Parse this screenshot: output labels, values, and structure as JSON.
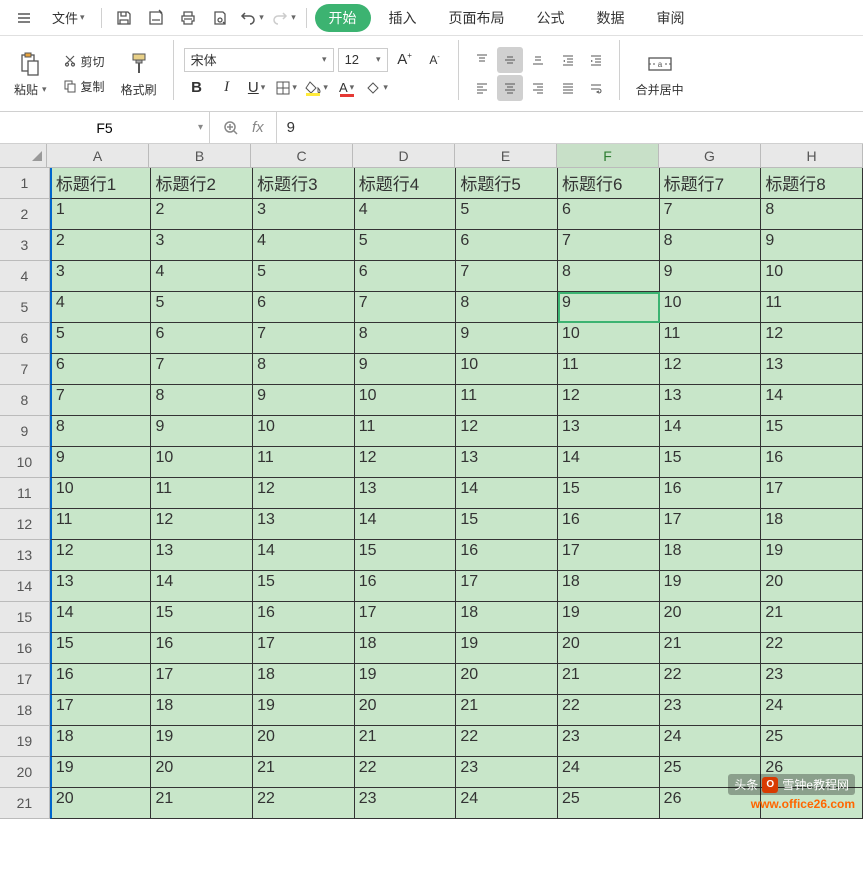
{
  "menubar": {
    "file": "文件",
    "tabs": [
      "开始",
      "插入",
      "页面布局",
      "公式",
      "数据",
      "审阅"
    ]
  },
  "ribbon": {
    "paste": "粘贴",
    "cut": "剪切",
    "copy": "复制",
    "format_painter": "格式刷",
    "font_name": "宋体",
    "font_size": "12",
    "bold": "B",
    "italic": "I",
    "underline": "U",
    "merge_center": "合并居中"
  },
  "formula_bar": {
    "name_box": "F5",
    "fx_label": "fx",
    "formula": "9"
  },
  "chart_data": {
    "type": "table",
    "active_cell": {
      "row": 5,
      "col": "F",
      "value": "9"
    },
    "columns": [
      "A",
      "B",
      "C",
      "D",
      "E",
      "F",
      "G",
      "H"
    ],
    "row_numbers": [
      1,
      2,
      3,
      4,
      5,
      6,
      7,
      8,
      9,
      10,
      11,
      12,
      13,
      14,
      15,
      16,
      17,
      18,
      19,
      20,
      21
    ],
    "headers": [
      "标题行1",
      "标题行2",
      "标题行3",
      "标题行4",
      "标题行5",
      "标题行6",
      "标题行7",
      "标题行8"
    ],
    "data": [
      [
        "1",
        "2",
        "3",
        "4",
        "5",
        "6",
        "7",
        "8"
      ],
      [
        "2",
        "3",
        "4",
        "5",
        "6",
        "7",
        "8",
        "9"
      ],
      [
        "3",
        "4",
        "5",
        "6",
        "7",
        "8",
        "9",
        "10"
      ],
      [
        "4",
        "5",
        "6",
        "7",
        "8",
        "9",
        "10",
        "11"
      ],
      [
        "5",
        "6",
        "7",
        "8",
        "9",
        "10",
        "11",
        "12"
      ],
      [
        "6",
        "7",
        "8",
        "9",
        "10",
        "11",
        "12",
        "13"
      ],
      [
        "7",
        "8",
        "9",
        "10",
        "11",
        "12",
        "13",
        "14"
      ],
      [
        "8",
        "9",
        "10",
        "11",
        "12",
        "13",
        "14",
        "15"
      ],
      [
        "9",
        "10",
        "11",
        "12",
        "13",
        "14",
        "15",
        "16"
      ],
      [
        "10",
        "11",
        "12",
        "13",
        "14",
        "15",
        "16",
        "17"
      ],
      [
        "11",
        "12",
        "13",
        "14",
        "15",
        "16",
        "17",
        "18"
      ],
      [
        "12",
        "13",
        "14",
        "15",
        "16",
        "17",
        "18",
        "19"
      ],
      [
        "13",
        "14",
        "15",
        "16",
        "17",
        "18",
        "19",
        "20"
      ],
      [
        "14",
        "15",
        "16",
        "17",
        "18",
        "19",
        "20",
        "21"
      ],
      [
        "15",
        "16",
        "17",
        "18",
        "19",
        "20",
        "21",
        "22"
      ],
      [
        "16",
        "17",
        "18",
        "19",
        "20",
        "21",
        "22",
        "23"
      ],
      [
        "17",
        "18",
        "19",
        "20",
        "21",
        "22",
        "23",
        "24"
      ],
      [
        "18",
        "19",
        "20",
        "21",
        "22",
        "23",
        "24",
        "25"
      ],
      [
        "19",
        "20",
        "21",
        "22",
        "23",
        "24",
        "25",
        "26"
      ],
      [
        "20",
        "21",
        "22",
        "23",
        "24",
        "25",
        "26"
      ]
    ]
  },
  "watermark": {
    "line1": "头条",
    "line1b": "雪钟e教程网",
    "line2": "www.office26.com"
  }
}
